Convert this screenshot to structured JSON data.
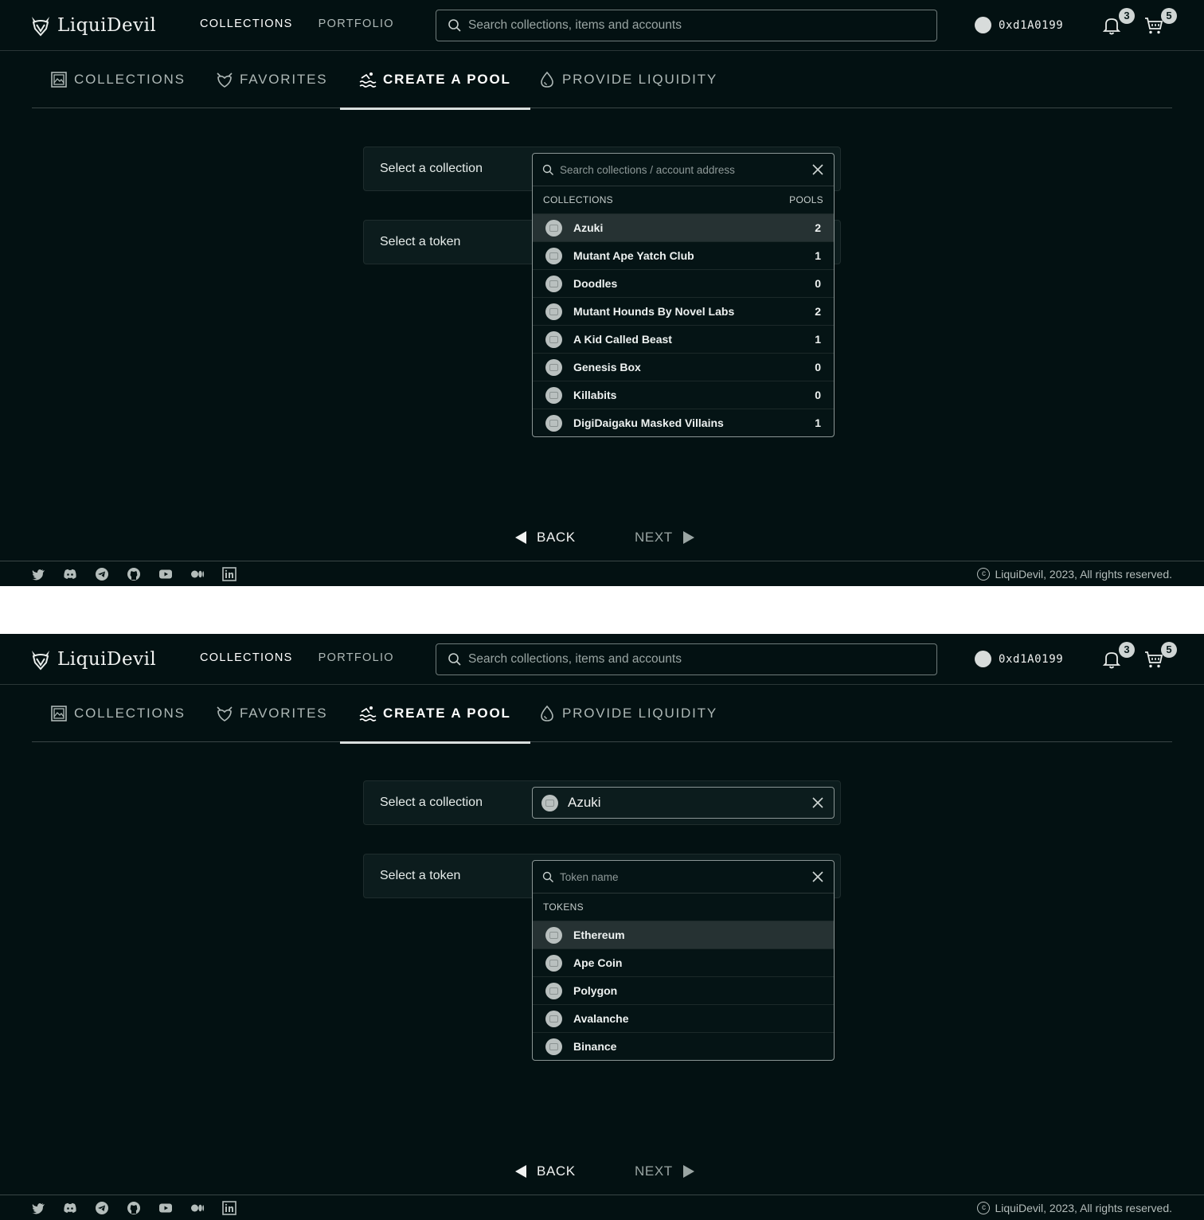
{
  "header": {
    "logo_text": "LiquiDevil",
    "nav": [
      "COLLECTIONS",
      "PORTFOLIO"
    ],
    "search_placeholder": "Search collections, items and accounts",
    "account": "0xd1A0199",
    "notifications_count": "3",
    "cart_count": "5"
  },
  "tabs": {
    "collections": "COLLECTIONS",
    "favorites": "FAVORITES",
    "create_pool": "CREATE A POOL",
    "provide_liquidity": "PROVIDE LIQUIDITY"
  },
  "form": {
    "collection_label": "Select a collection",
    "token_label": "Select a token",
    "selected_collection": "Azuki"
  },
  "collection_dropdown": {
    "placeholder": "Search collections / account address",
    "col_header": "COLLECTIONS",
    "count_header": "POOLS",
    "items": [
      {
        "name": "Azuki",
        "pools": "2"
      },
      {
        "name": "Mutant Ape Yatch Club",
        "pools": "1"
      },
      {
        "name": "Doodles",
        "pools": "0"
      },
      {
        "name": "Mutant Hounds By Novel Labs",
        "pools": "2"
      },
      {
        "name": "A Kid Called Beast",
        "pools": "1"
      },
      {
        "name": "Genesis Box",
        "pools": "0"
      },
      {
        "name": "Killabits",
        "pools": "0"
      },
      {
        "name": "DigiDaigaku Masked Villains",
        "pools": "1"
      }
    ]
  },
  "token_dropdown": {
    "placeholder": "Token name",
    "col_header": "TOKENS",
    "items": [
      "Ethereum",
      "Ape Coin",
      "Polygon",
      "Avalanche",
      "Binance"
    ]
  },
  "buttons": {
    "back": "BACK",
    "next": "NEXT"
  },
  "footer": {
    "socials": [
      "twitter-icon",
      "discord-icon",
      "telegram-icon",
      "github-icon",
      "youtube-icon",
      "medium-icon",
      "linkedin-icon"
    ],
    "copyright": "LiquiDevil, 2023, All rights reserved."
  },
  "colors": {
    "background": "#031112",
    "panel": "#0c1c1d",
    "hover_row": "#263233"
  }
}
